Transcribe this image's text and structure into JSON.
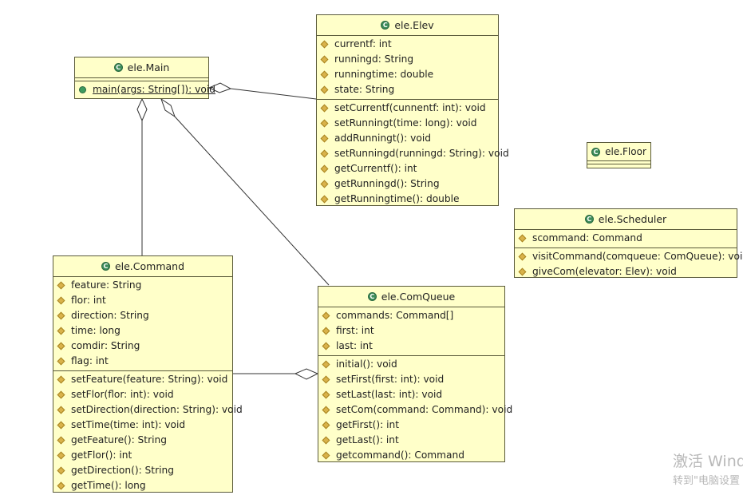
{
  "classes": {
    "main": {
      "name": "ele.Main",
      "attributes": [],
      "methods": [
        "main(args: String[]): void"
      ]
    },
    "elev": {
      "name": "ele.Elev",
      "attributes": [
        "currentf: int",
        "runningd: String",
        "runningtime: double",
        "state: String"
      ],
      "methods": [
        "setCurrentf(cunnentf: int): void",
        "setRunningt(time: long): void",
        "addRunningt(): void",
        "setRunningd(runningd: String): void",
        "getCurrentf(): int",
        "getRunningd(): String",
        "getRunningtime(): double"
      ]
    },
    "floor": {
      "name": "ele.Floor",
      "attributes": [],
      "methods": []
    },
    "scheduler": {
      "name": "ele.Scheduler",
      "attributes": [
        "scommand: Command"
      ],
      "methods": [
        "visitCommand(comqueue: ComQueue): void",
        "giveCom(elevator: Elev): void"
      ]
    },
    "command": {
      "name": "ele.Command",
      "attributes": [
        "feature: String",
        "flor: int",
        "direction: String",
        "time: long",
        "comdir: String",
        "flag: int"
      ],
      "methods": [
        "setFeature(feature: String): void",
        "setFlor(flor: int): void",
        "setDirection(direction: String): void",
        "setTime(time: int): void",
        "getFeature(): String",
        "getFlor(): int",
        "getDirection(): String",
        "getTime(): long"
      ]
    },
    "comqueue": {
      "name": "ele.ComQueue",
      "attributes": [
        "commands: Command[]",
        "first: int",
        "last: int"
      ],
      "methods": [
        "initial(): void",
        "setFirst(first: int): void",
        "setLast(last: int): void",
        "setCom(command: Command): void",
        "getFirst(): int",
        "getLast(): int",
        "getcommand(): Command"
      ]
    }
  },
  "class_icon_letter": "C",
  "watermark": {
    "line1": "激活 Wind",
    "line2": "转到\"电脑设置"
  },
  "colors": {
    "class_fill": "#ffffc9",
    "class_border": "#5a5a3a",
    "class_icon": "#3d8c5a",
    "field_icon": "#d9b24a",
    "line": "#333333"
  }
}
